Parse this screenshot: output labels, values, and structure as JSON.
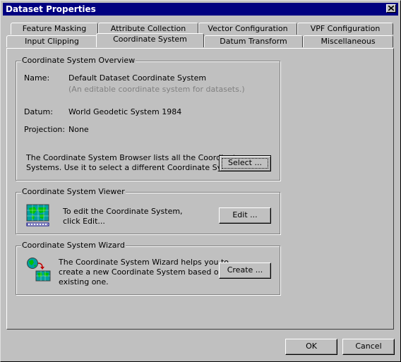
{
  "window": {
    "title": "Dataset Properties"
  },
  "tabs": {
    "back_row": [
      "Feature Masking",
      "Attribute Collection",
      "Vector Configuration",
      "VPF Configuration"
    ],
    "front_row": [
      "Input Clipping",
      "Coordinate System",
      "Datum Transform",
      "Miscellaneous"
    ],
    "active": "Coordinate System"
  },
  "overview": {
    "title": "Coordinate System Overview",
    "name_label": "Name:",
    "name_value": "Default Dataset Coordinate System",
    "name_desc": "(An editable coordinate system for datasets.)",
    "datum_label": "Datum:",
    "datum_value": "World Geodetic System 1984",
    "projection_label": "Projection:",
    "projection_value": "None",
    "browser_text_1": "The Coordinate System Browser lists all the Coordinate",
    "browser_text_2": "Systems.  Use it to select a different Coordinate System.",
    "select_button": "Select ..."
  },
  "viewer": {
    "title": "Coordinate System Viewer",
    "text_1": "To edit the Coordinate System,",
    "text_2": "click Edit...",
    "edit_button": "Edit ..."
  },
  "wizard": {
    "title": "Coordinate System Wizard",
    "text_1": "The Coordinate System Wizard helps you to",
    "text_2": "create a new Coordinate System based on an",
    "text_3": "existing one.",
    "create_button": "Create ..."
  },
  "footer": {
    "ok_button": "OK",
    "cancel_button": "Cancel"
  },
  "icons": {
    "close": "close-icon",
    "viewer": "map-grid-icon",
    "wizard": "globe-arrow-map-icon"
  },
  "colors": {
    "titlebar": "#000080",
    "dialog": "#c0c0c0",
    "map_sea": "#00a0a0",
    "map_land": "#00c000"
  }
}
